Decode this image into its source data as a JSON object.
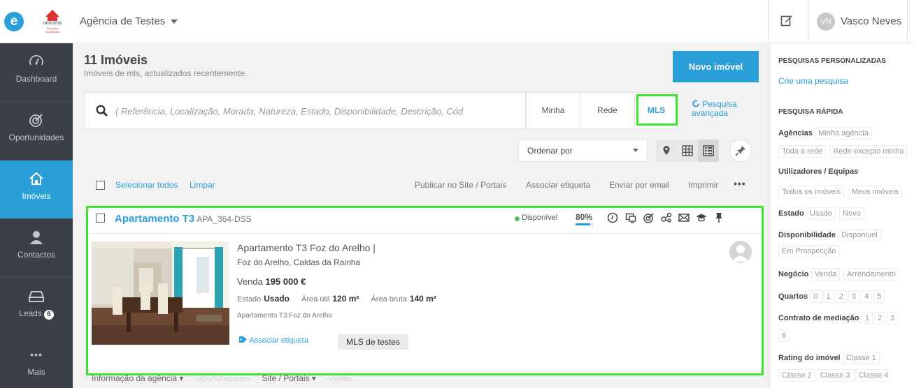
{
  "header": {
    "app_logo": "e",
    "agency_logo_name": "imosima",
    "agency_logo_tagline": "Soluções Imobiliárias",
    "agency": "Agência de Testes",
    "edit_icon": "edit-icon",
    "user_initials": "VN",
    "user_name": "Vasco Neves"
  },
  "nav": {
    "items": [
      {
        "label": "Dashboard",
        "icon": "gauge-icon"
      },
      {
        "label": "Oportunidades",
        "icon": "target-icon"
      },
      {
        "label": "Imóveis",
        "icon": "house-icon",
        "active": true
      },
      {
        "label": "Contactos",
        "icon": "person-icon"
      },
      {
        "label": "Leads",
        "icon": "inbox-icon",
        "badge": "6"
      },
      {
        "label": "Mais",
        "icon": "more-icon",
        "glyph": "•••"
      }
    ]
  },
  "main": {
    "title": "11 Imóveis",
    "subtitle": "Imóveis de mls, actualizados recentemente.",
    "new_button": "Novo imóvel",
    "search": {
      "placeholder": "( Referência, Localização, Morada, Natureza, Estado, Disponibilidade, Descrição, Cód"
    },
    "scope_tabs": [
      "Minha",
      "Rede",
      "MLS"
    ],
    "active_scope": "MLS",
    "advanced_search_l1": "Pesquisa",
    "advanced_search_l2": "avançada",
    "sort_label": "Ordenar por",
    "view_modes": [
      "map-pin-icon",
      "grid-icon",
      "list-icon"
    ],
    "select_all": "Selecionar todos",
    "clear": "Limpar",
    "bulk_actions": [
      "Publicar no Site / Portais",
      "Associar etiqueta",
      "Enviar por email",
      "Imprimir"
    ],
    "more": "•••"
  },
  "listing": {
    "title": "Apartamento T3",
    "reference": "APA_364-DSS",
    "status": "Disponível",
    "status_color": "#5cb85c",
    "score": "80%",
    "score_value": 0.8,
    "name": "Apartamento T3 Foz do Arelho |",
    "location": "Foz do Arelho, Caldas da Rainha",
    "price_label": "Venda",
    "price": "195 000 €",
    "state_label": "Estado",
    "state": "Usado",
    "useful_area_label": "Área útil",
    "useful_area": "120 m²",
    "gross_area_label": "Área bruta",
    "gross_area": "140 m²",
    "description": "Apartamento T3 Foz do Arelho",
    "tag_action": "Associar etiqueta",
    "tag": "MLS de testes",
    "footer": [
      "Informação da agência ▾",
      "Oportunidades",
      "Site / Portais ▾",
      "Visitas"
    ]
  },
  "rightbar": {
    "custom_title": "PESQUISAS PERSONALIZADAS",
    "create_search": "Crie uma pesquisa",
    "quick_title": "PESQUISA RÁPIDA",
    "agencies_label": "Agências",
    "agencies": [
      "Minha agência",
      "Toda a rede",
      "Rede excepto minha"
    ],
    "users_label": "Utilizadores / Equipas",
    "users": [
      "Todos os imóveis",
      "Meus imóveis"
    ],
    "state_label": "Estado",
    "states": [
      "Usado",
      "Novo"
    ],
    "availability_label": "Disponibilidade",
    "availability": [
      "Disponível",
      "Em Prospecção"
    ],
    "business_label": "Negócio",
    "business": [
      "Venda",
      "Arrendamento"
    ],
    "rooms_label": "Quartos",
    "rooms": [
      "0",
      "1",
      "2",
      "3",
      "4",
      "5"
    ],
    "contract_label": "Contrato de mediação",
    "contract": [
      "1",
      "2",
      "3",
      "6"
    ],
    "rating_label": "Rating do imóvel",
    "rating": [
      "Classe 1",
      "Classe 2",
      "Classe 3",
      "Classe 4"
    ]
  },
  "colors": {
    "accent": "#2a9fd8",
    "sidebar_bg": "#3b3f46",
    "highlight": "#3ae62e"
  }
}
